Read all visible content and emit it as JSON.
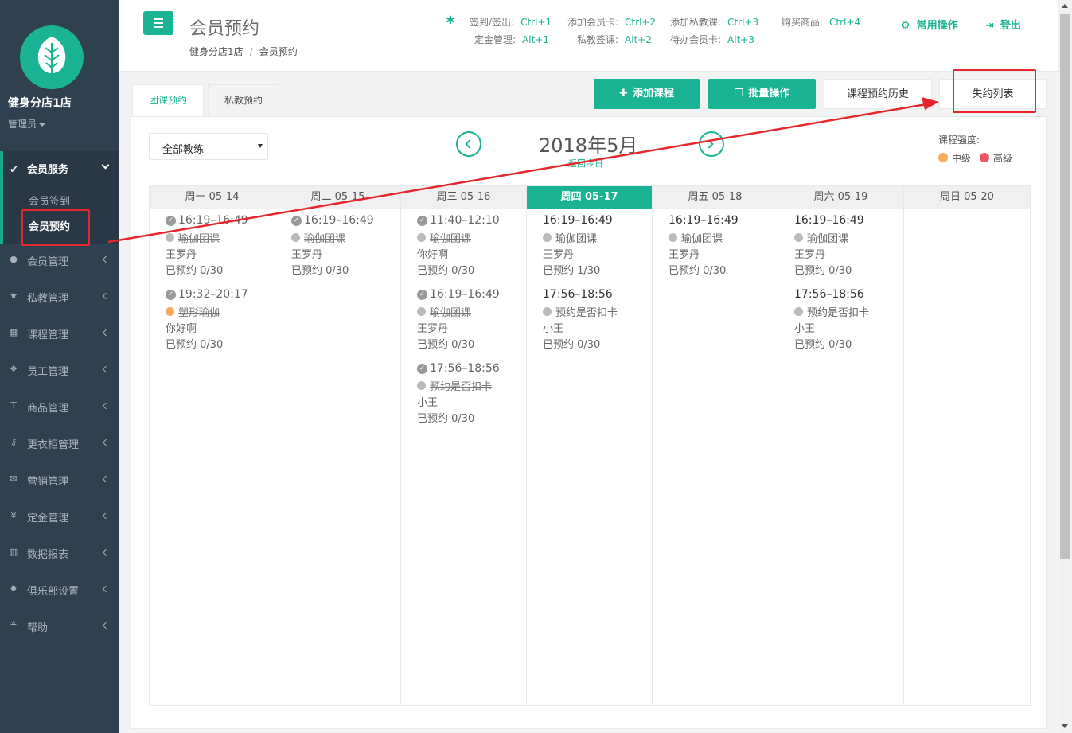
{
  "sidebar": {
    "store_name": "健身分店1店",
    "role": "管理员",
    "active_group": {
      "label": "会员服务",
      "children": [
        "会员签到",
        "会员预约"
      ]
    },
    "items": [
      {
        "label": "会员管理",
        "icon": "user-icon"
      },
      {
        "label": "私教管理",
        "icon": "star-icon"
      },
      {
        "label": "课程管理",
        "icon": "calendar-icon"
      },
      {
        "label": "员工管理",
        "icon": "users-icon"
      },
      {
        "label": "商品管理",
        "icon": "cart-icon"
      },
      {
        "label": "更衣柜管理",
        "icon": "key-icon"
      },
      {
        "label": "营销管理",
        "icon": "envelope-icon"
      },
      {
        "label": "定金管理",
        "icon": "yen-icon"
      },
      {
        "label": "数据报表",
        "icon": "bar-chart-icon"
      },
      {
        "label": "俱乐部设置",
        "icon": "gear-icon"
      },
      {
        "label": "帮助",
        "icon": "graduation-cap-icon"
      }
    ]
  },
  "header": {
    "title": "会员预约",
    "breadcrumb": [
      "健身分店1店",
      "会员预约"
    ],
    "shortcuts": [
      {
        "label": "签到/签出:",
        "key": "Ctrl+1"
      },
      {
        "label": "添加会员卡:",
        "key": "Ctrl+2"
      },
      {
        "label": "添加私教课:",
        "key": "Ctrl+3"
      },
      {
        "label": "购买商品:",
        "key": "Ctrl+4"
      },
      {
        "label": "定金管理:",
        "key": "Alt+1"
      },
      {
        "label": "私教签课:",
        "key": "Alt+2"
      },
      {
        "label": "待办会员卡:",
        "key": "Alt+3"
      }
    ],
    "common_ops": "常用操作",
    "logout": "登出"
  },
  "tabs": [
    "团课预约",
    "私教预约"
  ],
  "toolbar": {
    "add_course": "添加课程",
    "batch": "批量操作",
    "history": "课程预约历史",
    "missed": "失约列表"
  },
  "filter": {
    "coach": "全部教练"
  },
  "calendar": {
    "month": "2018年5月",
    "back_today": "返回今日",
    "intensity_label": "课程强度:",
    "legend": [
      {
        "label": "中级",
        "color": "#f8ac59"
      },
      {
        "label": "高级",
        "color": "#ed5565"
      }
    ],
    "days": [
      {
        "head": "周一 05-14",
        "events": [
          {
            "time": "16:19–16:49",
            "name": "瑜伽团课",
            "coach": "王罗丹",
            "booked": "已预约 0/30",
            "past": true
          },
          {
            "time": "19:32–20:17",
            "name": "塑形瑜伽",
            "coach": "你好啊",
            "booked": "已预约 0/30",
            "past": true
          }
        ]
      },
      {
        "head": "周二 05-15",
        "events": [
          {
            "time": "16:19–16:49",
            "name": "瑜伽团课",
            "coach": "王罗丹",
            "booked": "已预约 0/30",
            "past": true
          }
        ]
      },
      {
        "head": "周三 05-16",
        "events": [
          {
            "time": "11:40–12:10",
            "name": "瑜伽团课",
            "coach": "你好啊",
            "booked": "已预约 0/30",
            "past": true
          },
          {
            "time": "16:19–16:49",
            "name": "瑜伽团课",
            "coach": "王罗丹",
            "booked": "已预约 0/30",
            "past": true
          },
          {
            "time": "17:56–18:56",
            "name": "预约是否扣卡",
            "coach": "小王",
            "booked": "已预约 0/30",
            "past": true
          }
        ]
      },
      {
        "head": "周四 05-17",
        "today": true,
        "events": [
          {
            "time": "16:19–16:49",
            "name": "瑜伽团课",
            "coach": "王罗丹",
            "booked": "已预约 1/30"
          },
          {
            "time": "17:56–18:56",
            "name": "预约是否扣卡",
            "coach": "小王",
            "booked": "已预约 0/30"
          }
        ]
      },
      {
        "head": "周五 05-18",
        "events": [
          {
            "time": "16:19–16:49",
            "name": "瑜伽团课",
            "coach": "王罗丹",
            "booked": "已预约 0/30"
          }
        ]
      },
      {
        "head": "周六 05-19",
        "events": [
          {
            "time": "16:19–16:49",
            "name": "瑜伽团课",
            "coach": "王罗丹",
            "booked": "已预约 0/30"
          },
          {
            "time": "17:56–18:56",
            "name": "预约是否扣卡",
            "coach": "小王",
            "booked": "已预约 0/30"
          }
        ]
      },
      {
        "head": "周日 05-20",
        "events": []
      }
    ]
  },
  "colors": {
    "primary": "#1ab394",
    "sidebar": "#2f4050",
    "annotation": "#e5262c",
    "past_dot": "#bbbbbb"
  }
}
